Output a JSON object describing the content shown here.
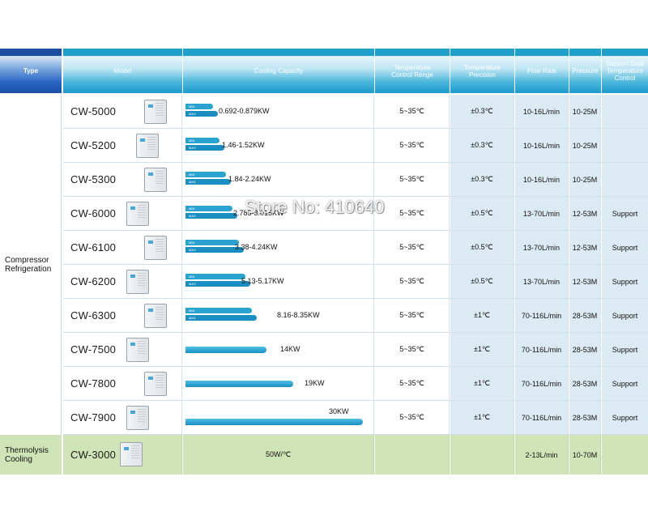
{
  "header": {
    "type": "Type",
    "model": "Model",
    "capacity": "Cooling Capacity",
    "range": [
      "Temperature",
      "Control Renge"
    ],
    "precision": [
      "Temperature",
      "Precision"
    ],
    "flow": "Flow Rate",
    "pressure": "Pressure",
    "support": [
      "Support Dual",
      "Temperature",
      "Control"
    ]
  },
  "types": {
    "compressor": [
      "Compressor",
      "Refrigeration"
    ],
    "thermo": [
      "Thermolysis",
      "Cooling"
    ]
  },
  "minmax_labels": {
    "min": "MIN",
    "max": "MAX"
  },
  "rows": [
    {
      "model": "CW-5000",
      "capacity": "0.692-0.879KW",
      "range": "5~35℃",
      "precision": "±0.3℃",
      "flow": "10-16L/min",
      "pressure": "10-25M",
      "support": ""
    },
    {
      "model": "CW-5200",
      "capacity": "1.46-1.52KW",
      "range": "5~35℃",
      "precision": "±0.3℃",
      "flow": "10-16L/min",
      "pressure": "10-25M",
      "support": ""
    },
    {
      "model": "CW-5300",
      "capacity": "1.84-2.24KW",
      "range": "5~35℃",
      "precision": "±0.3℃",
      "flow": "10-16L/min",
      "pressure": "10-25M",
      "support": ""
    },
    {
      "model": "CW-6000",
      "capacity": "2.785-3.015KW",
      "range": "5~35℃",
      "precision": "±0.5℃",
      "flow": "13-70L/min",
      "pressure": "12-53M",
      "support": "Support"
    },
    {
      "model": "CW-6100",
      "capacity": "3.38-4.24KW",
      "range": "5~35℃",
      "precision": "±0.5℃",
      "flow": "13-70L/min",
      "pressure": "12-53M",
      "support": "Support"
    },
    {
      "model": "CW-6200",
      "capacity": "5.13-5.17KW",
      "range": "5~35℃",
      "precision": "±0.5℃",
      "flow": "13-70L/min",
      "pressure": "12-53M",
      "support": "Support"
    },
    {
      "model": "CW-6300",
      "capacity": "8.16-8.35KW",
      "range": "5~35℃",
      "precision": "±1℃",
      "flow": "70-116L/min",
      "pressure": "28-53M",
      "support": "Support"
    },
    {
      "model": "CW-7500",
      "capacity": "14KW",
      "range": "5~35℃",
      "precision": "±1℃",
      "flow": "70-116L/min",
      "pressure": "28-53M",
      "support": "Support"
    },
    {
      "model": "CW-7800",
      "capacity": "19KW",
      "range": "5~35℃",
      "precision": "±1℃",
      "flow": "70-116L/min",
      "pressure": "28-53M",
      "support": "Support"
    },
    {
      "model": "CW-7900",
      "capacity": "30KW",
      "range": "5~35℃",
      "precision": "±1℃",
      "flow": "70-116L/min",
      "pressure": "28-53M",
      "support": "Support"
    }
  ],
  "thermo_row": {
    "model": "CW-3000",
    "capacity": "50W/℃",
    "range": "",
    "precision": "",
    "flow": "2-13L/min",
    "pressure": "10-70M",
    "support": ""
  },
  "watermark": "Store No: 410640",
  "colors": {
    "header_blue": "#1f9fc9",
    "type_header": "#1b4ea0",
    "bar_blue": "#2aa3d1",
    "thermo_green": "#cfe5b7",
    "spec_cell": "#dcebf3"
  }
}
